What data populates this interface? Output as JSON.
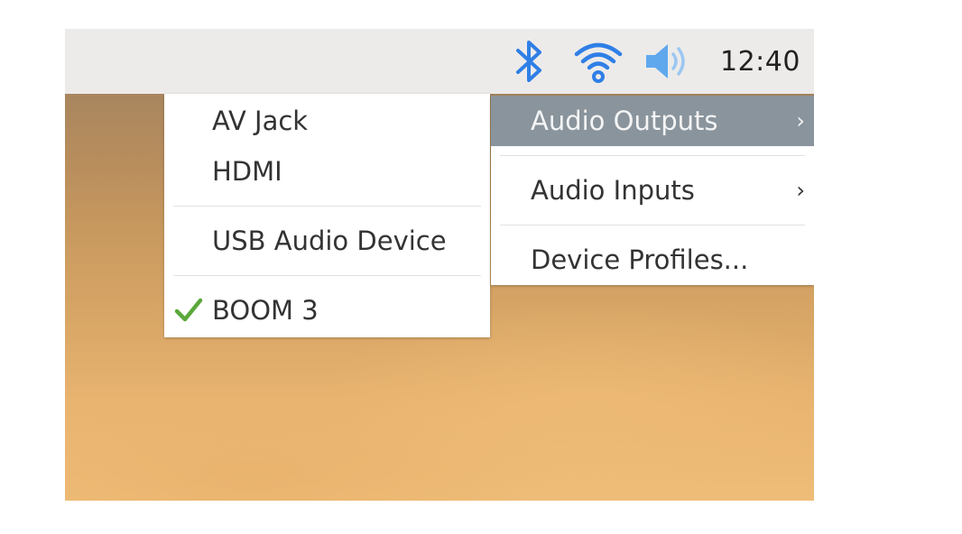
{
  "taskbar": {
    "icons": [
      "bluetooth-icon",
      "wifi-icon",
      "volume-icon"
    ],
    "clock": "12:40",
    "icon_color": "#2f7fe6"
  },
  "main_menu": {
    "items": [
      {
        "label": "Audio Outputs",
        "has_submenu": true,
        "active": true
      },
      {
        "label": "Audio Inputs",
        "has_submenu": true,
        "active": false
      },
      {
        "label": "Device Profiles...",
        "has_submenu": false,
        "active": false
      }
    ],
    "arrow_glyph": "›",
    "active_color": "#8a949c"
  },
  "submenu": {
    "items": [
      {
        "label": "AV Jack",
        "checked": false
      },
      {
        "label": "HDMI",
        "checked": false
      },
      {
        "label": "USB Audio Device",
        "checked": false
      },
      {
        "label": "BOOM 3",
        "checked": true
      }
    ],
    "check_color": "#5aa83a"
  }
}
